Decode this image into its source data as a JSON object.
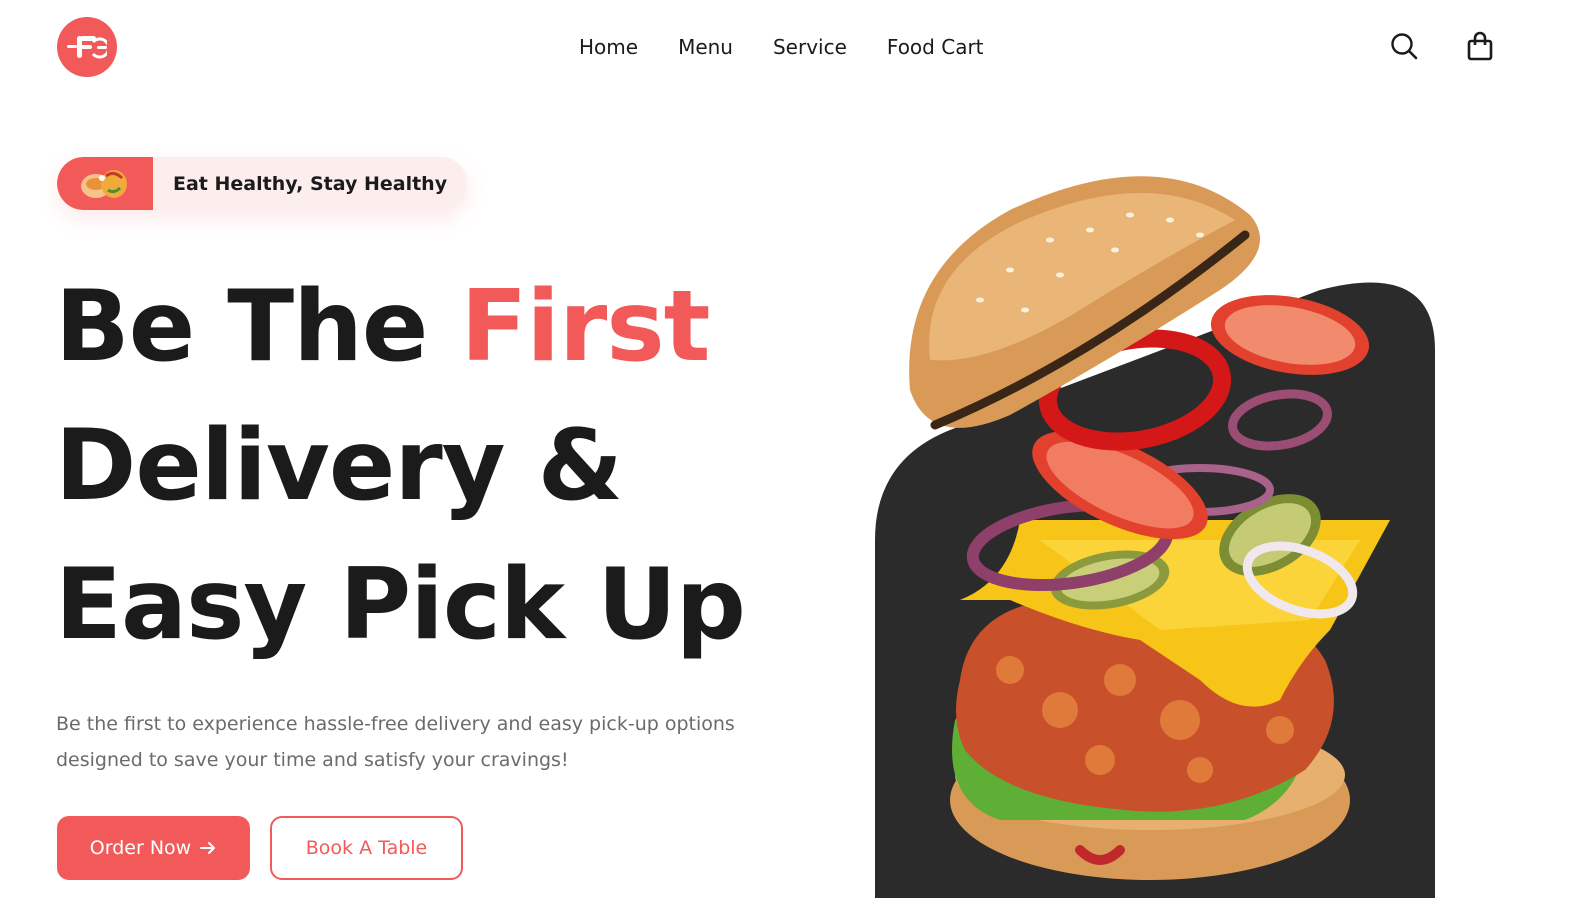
{
  "header": {
    "logo_icon": "fork-letter-f-logo",
    "nav": [
      {
        "label": "Home"
      },
      {
        "label": "Menu"
      },
      {
        "label": "Service"
      },
      {
        "label": "Food Cart"
      }
    ],
    "actions": {
      "search_icon": "search-icon",
      "cart_icon": "shopping-bag-icon"
    }
  },
  "hero": {
    "tagline": "Eat Healthy, Stay Healthy",
    "headline": {
      "line1_prefix": "Be The ",
      "line1_accent": "First",
      "line2": "Delivery &",
      "line3": "Easy Pick Up"
    },
    "description": "Be the first to experience hassle-free delivery and easy pick-up options designed to save your time and satisfy your cravings!",
    "primary_button": "Order Now",
    "secondary_button": "Book A Table",
    "image": "exploded-chicken-burger"
  },
  "colors": {
    "accent": "#f25a5a",
    "text": "#1b1b1b",
    "muted": "#6b6b6b",
    "pill_bg": "#fdeeee",
    "dark_shape": "#2b2b2b"
  }
}
